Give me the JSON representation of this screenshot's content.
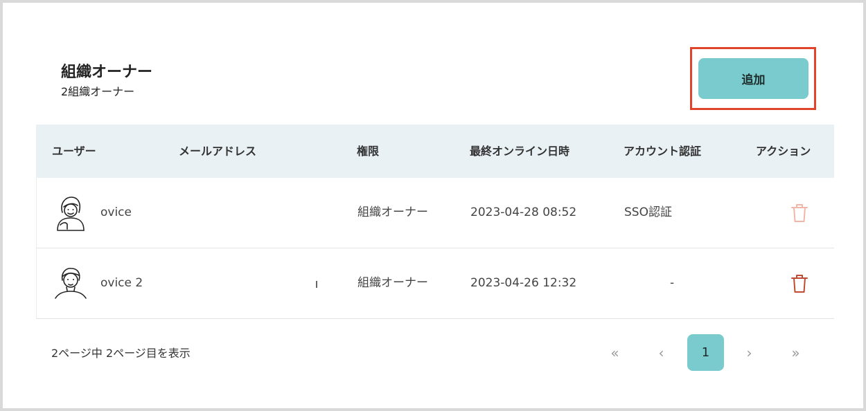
{
  "header": {
    "title": "組織オーナー",
    "subtitle": "2組織オーナー",
    "add_label": "追加"
  },
  "table": {
    "columns": [
      "ユーザー",
      "メールアドレス",
      "権限",
      "最終オンライン日時",
      "アカウント認証",
      "アクション"
    ],
    "rows": [
      {
        "user": "ovice",
        "email": "",
        "role": "組織オーナー",
        "last_online": "2023-04-28 08:52",
        "auth": "SSO認証",
        "avatar_icon": "female-avatar-icon",
        "delete_icon": "trash-icon"
      },
      {
        "user": "ovice 2",
        "email": "",
        "role": "組織オーナー",
        "last_online": "2023-04-26 12:32",
        "auth": "-",
        "avatar_icon": "male-avatar-icon",
        "delete_icon": "trash-icon"
      }
    ]
  },
  "pagination": {
    "info": "2ページ中 2ページ目を表示",
    "first": "«",
    "prev": "‹",
    "current": "1",
    "next": "›",
    "last": "»"
  },
  "colors": {
    "accent": "#79cbcd",
    "header_bg": "#e9f1f5",
    "highlight": "#e0452b",
    "delete_disabled": "#f0b7a8",
    "delete_enabled": "#c04a33"
  }
}
